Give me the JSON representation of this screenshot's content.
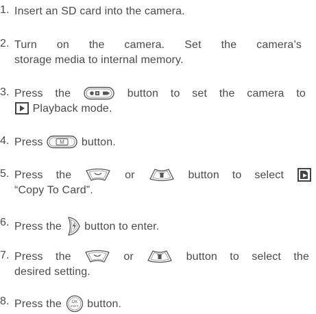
{
  "steps": [
    {
      "number": "1.",
      "text": "Insert an SD card into the camera."
    },
    {
      "number": "2.",
      "line1": "Turn on the camera. Set the camera’s",
      "line2": "storage media to internal memory."
    },
    {
      "number": "3.",
      "pre": "Press the",
      "post": "button to set the camera to",
      "line2": "Playback mode."
    },
    {
      "number": "4.",
      "pre": "Press",
      "post": "button."
    },
    {
      "number": "5.",
      "pre": "Press the",
      "mid": "or",
      "post": "button to select",
      "line2": "“Copy To Card”."
    },
    {
      "number": "6.",
      "pre": "Press the",
      "post": "button to enter."
    },
    {
      "number": "7.",
      "pre": "Press the",
      "mid": "or",
      "post": "button to select the",
      "line2": "desired setting."
    },
    {
      "number": "8.",
      "pre": "Press the",
      "post": "button."
    }
  ],
  "icons": {
    "mode_button": "playback-mode-button-icon",
    "playback": "playback-icon",
    "menu_button": "menu-button-icon",
    "up": "up-button-icon",
    "down": "down-delete-button-icon",
    "copy_card": "copy-to-card-icon",
    "flash": "flash-button-icon",
    "ok_button": "ok-edit-button-icon",
    "ok_label_top": "OK",
    "ok_label_bottom": "EDIT",
    "menu_letter": "M"
  }
}
